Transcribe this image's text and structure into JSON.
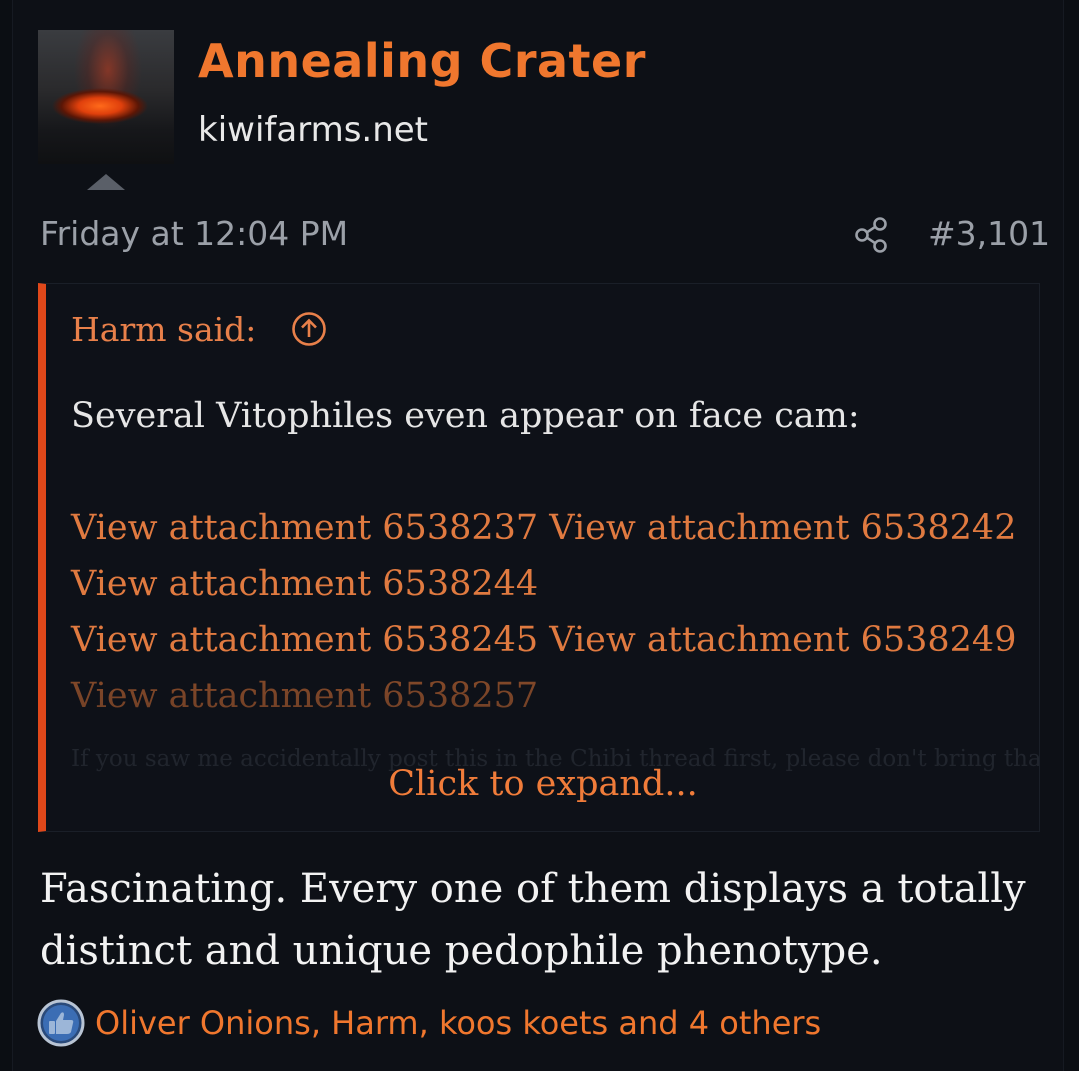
{
  "post": {
    "username": "Annealing Crater",
    "site": "kiwifarms.net",
    "timestamp": "Friday at 12:04 PM",
    "post_number": "#3,101",
    "share_icon": "share-icon"
  },
  "quote": {
    "author_label": "Harm said:",
    "jump_icon": "arrow-up-circle-icon",
    "line1": "Several Vitophiles even appear on face cam:",
    "attachments": [
      "View attachment 6538237 View attachment 6538242",
      "View attachment 6538244",
      "View attachment 6538245 View attachment 6538249",
      "View attachment 6538257"
    ],
    "faded_text": "If you saw me accidentally post this in the Chibi thread first, please don't bring that",
    "expand_label": "Click to expand..."
  },
  "body": {
    "text": "Fascinating. Every one of them displays a totally distinct and unique pedophile phenotype."
  },
  "reactions": {
    "icon": "thumbs-up-icon",
    "text": "Oliver Onions, Harm, koos koets and 4 others"
  },
  "colors": {
    "accent": "#f0772e",
    "quote_border": "#e0481a",
    "background": "#0d1016"
  }
}
